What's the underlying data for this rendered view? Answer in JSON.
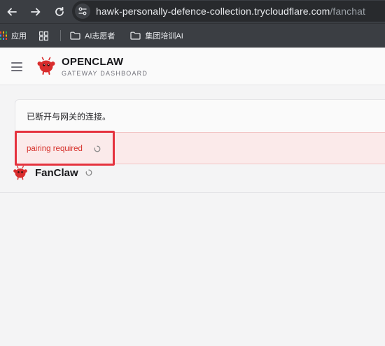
{
  "browser": {
    "url_host": "hawk-personally-defence-collection.trycloudflare.com",
    "url_path": "/fanchat",
    "bookmarks": [
      {
        "label": "应用",
        "icon": "apps-grid-icon"
      },
      {
        "label": "",
        "icon": "grid-icon"
      },
      {
        "label": "AI志愿者",
        "icon": "folder-icon"
      },
      {
        "label": "集团培训AI",
        "icon": "folder-icon"
      }
    ]
  },
  "header": {
    "title": "OPENCLAW",
    "subtitle": "GATEWAY DASHBOARD"
  },
  "status": {
    "message": "已断开与网关的连接。",
    "error": "pairing required"
  },
  "agent": {
    "name": "FanClaw"
  },
  "colors": {
    "accent": "#d6312b",
    "highlight": "#e5323e",
    "error_bg": "#fbeaea"
  }
}
